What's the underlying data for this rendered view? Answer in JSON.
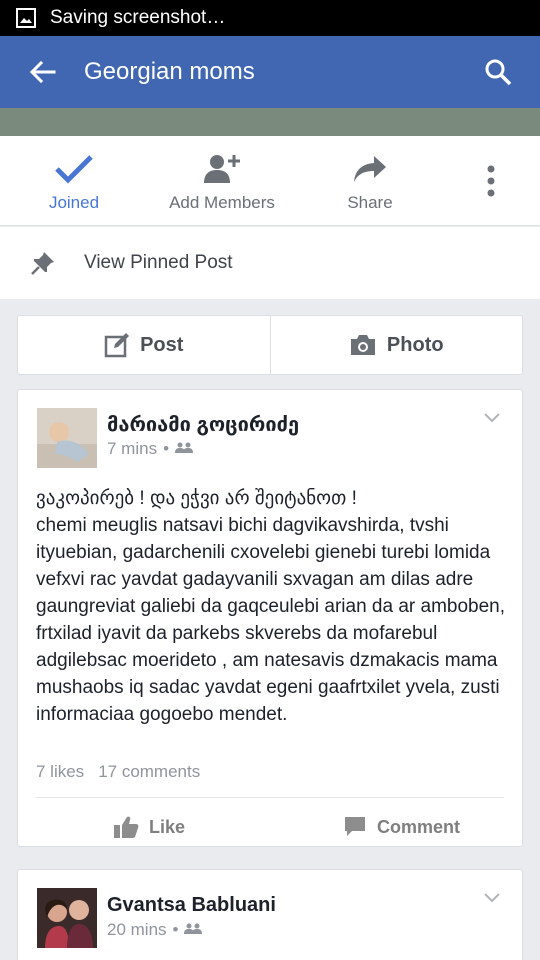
{
  "status_bar": {
    "text": "Saving screenshot…",
    "icon": "image-icon"
  },
  "header": {
    "title": "Georgian moms",
    "back_icon": "back-arrow-icon",
    "search_icon": "search-icon",
    "color": "#4267b2"
  },
  "group_actions": {
    "joined": "Joined",
    "add_members": "Add Members",
    "share": "Share",
    "more_icon": "more-vertical-icon",
    "accent": "#4a76d3"
  },
  "pinned": {
    "label": "View Pinned Post",
    "icon": "pin-icon"
  },
  "composer": {
    "post_label": "Post",
    "photo_label": "Photo"
  },
  "posts": [
    {
      "author": "მარიამი გოცირიძე",
      "time": "7 mins",
      "dot": "•",
      "audience_icon": "group-icon",
      "text": "ვაკოპირებ ! და ეჭვი არ შეიტანოთ !\nchemi meuglis natsavi bichi dagvikavshirda, tvshi ityuebian, gadarchenili cxovelebi gienebi turebi lomida vefxvi rac yavdat gadayvanili sxvagan am dilas adre gaungreviat galiebi da gaqceulebi arian da ar amboben, frtxilad iyavit da parkebs skverebs da mofarebul adgilebsac moerideto , am natesavis dzmakacis mama mushaobs iq sadac yavdat egeni gaafrtxilet yvela, zusti informaciaa gogoebo mendet.",
      "likes": "7 likes",
      "comments": "17 comments",
      "like_label": "Like",
      "comment_label": "Comment"
    },
    {
      "author": "Gvantsa Babluani",
      "time": "20 mins",
      "dot": "•",
      "audience_icon": "group-icon"
    }
  ]
}
